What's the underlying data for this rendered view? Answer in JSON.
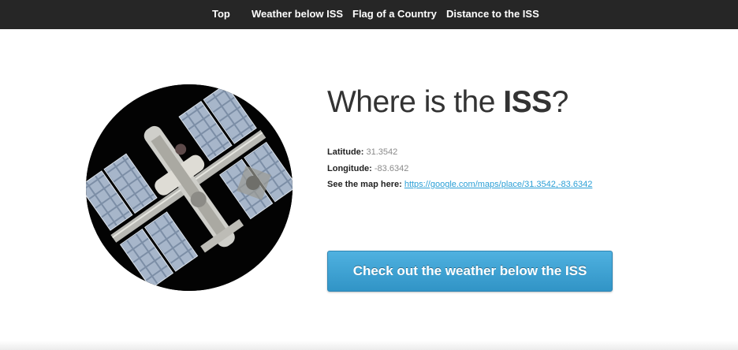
{
  "nav": {
    "items": [
      {
        "label": "Top"
      },
      {
        "label": "Weather below ISS"
      },
      {
        "label": "Flag of a Country"
      },
      {
        "label": "Distance to the ISS"
      }
    ]
  },
  "hero": {
    "title_prefix": "Where is the ",
    "title_strong": "ISS",
    "title_suffix": "?",
    "latitude_label": "Latitude:",
    "latitude_value": "31.3542",
    "longitude_label": "Longitude:",
    "longitude_value": "-83.6342",
    "map_label": "See the map here:",
    "map_link": "https://google.com/maps/place/31.3542,-83.6342",
    "cta_label": "Check out the weather below the ISS"
  },
  "colors": {
    "nav_bg": "#262626",
    "link": "#2a9fd6",
    "button": "#3a9fd3"
  }
}
